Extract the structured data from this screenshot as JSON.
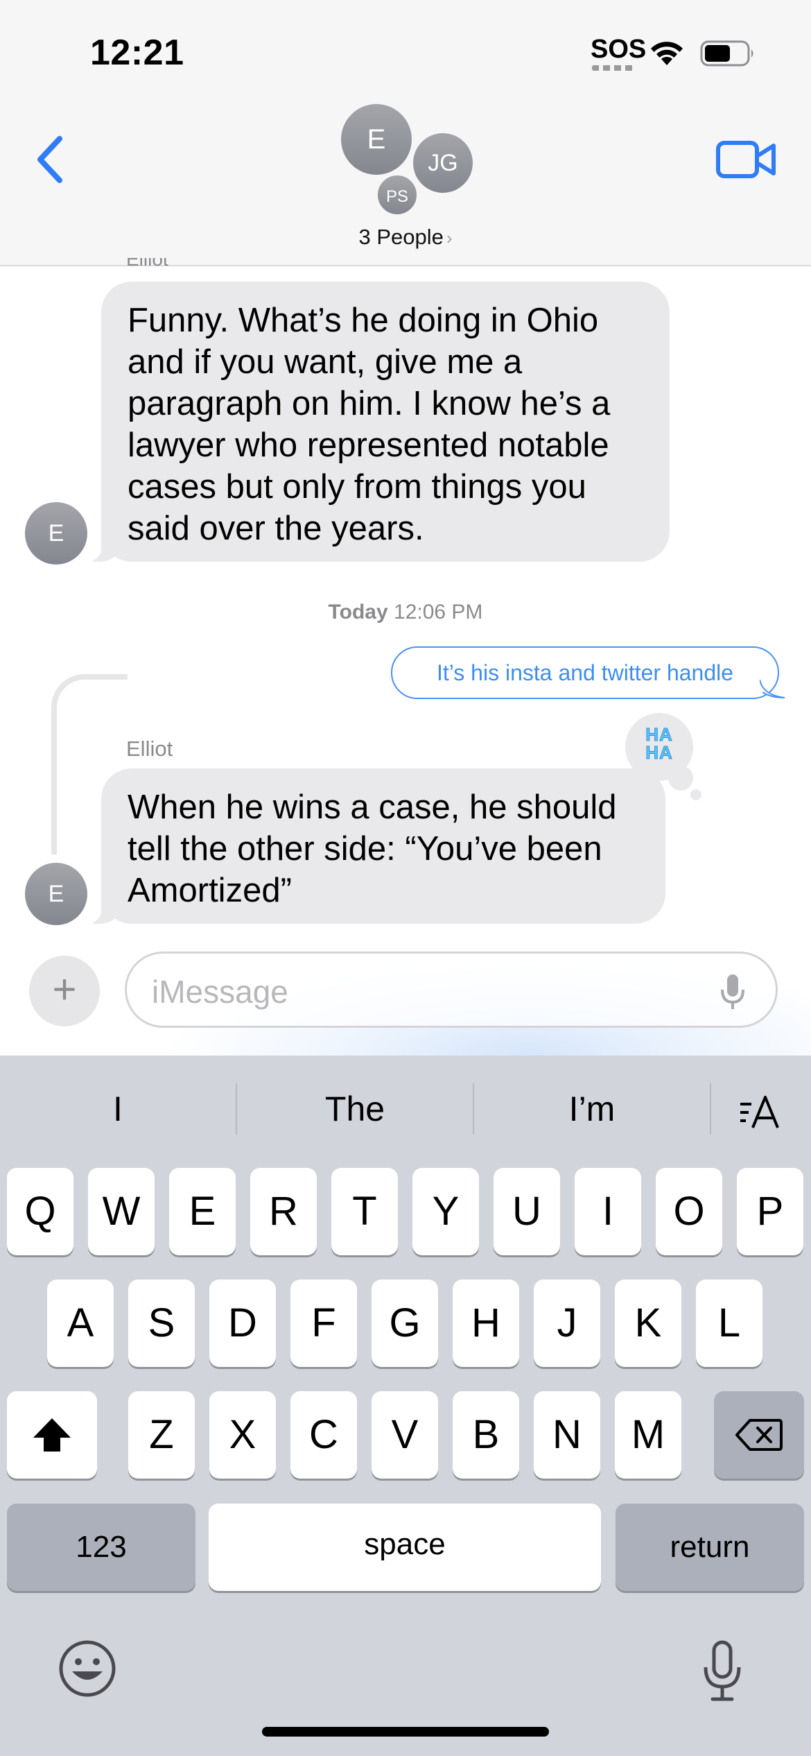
{
  "status_bar": {
    "time": "12:21",
    "sos": "SOS",
    "wifi_icon": "wifi-icon",
    "battery_icon": "battery-icon"
  },
  "header": {
    "back_icon": "chevron-left-icon",
    "avatars": [
      "E",
      "JG",
      "PS"
    ],
    "people_label": "3 People",
    "people_chevron": "›",
    "facetime_icon": "video-camera-icon"
  },
  "thread": {
    "cut_sender": "Elliot",
    "message1": {
      "avatar": "E",
      "lines": [
        "Funny.  What’s he doing in Ohio",
        "and if you want, give me a",
        "paragraph on him.  I know he’s a",
        "lawyer who represented notable",
        "cases but only from things you",
        "said over the years."
      ]
    },
    "timestamp_day": "Today",
    "timestamp_time": "12:06 PM",
    "outgoing_reply": "It’s his insta and twitter handle",
    "message2": {
      "sender": "Elliot",
      "avatar": "E",
      "lines": [
        "When he wins a case, he should",
        "tell the other side: “You’ve been",
        "Amortized”"
      ],
      "tapback_line1": "HA",
      "tapback_line2": "HA"
    }
  },
  "composer": {
    "plus": "+",
    "placeholder": "iMessage",
    "mic_icon": "microphone-icon"
  },
  "keyboard": {
    "suggestions": [
      "I",
      "The",
      "I’m"
    ],
    "format_icon": "text-format-icon",
    "row1": [
      "Q",
      "W",
      "E",
      "R",
      "T",
      "Y",
      "U",
      "I",
      "O",
      "P"
    ],
    "row2": [
      "A",
      "S",
      "D",
      "F",
      "G",
      "H",
      "J",
      "K",
      "L"
    ],
    "row3": [
      "Z",
      "X",
      "C",
      "V",
      "B",
      "N",
      "M"
    ],
    "numbers": "123",
    "space": "space",
    "return": "return",
    "shift_icon": "shift-icon",
    "delete_icon": "delete-icon",
    "emoji_icon": "emoji-icon",
    "dictation_icon": "microphone-icon"
  }
}
